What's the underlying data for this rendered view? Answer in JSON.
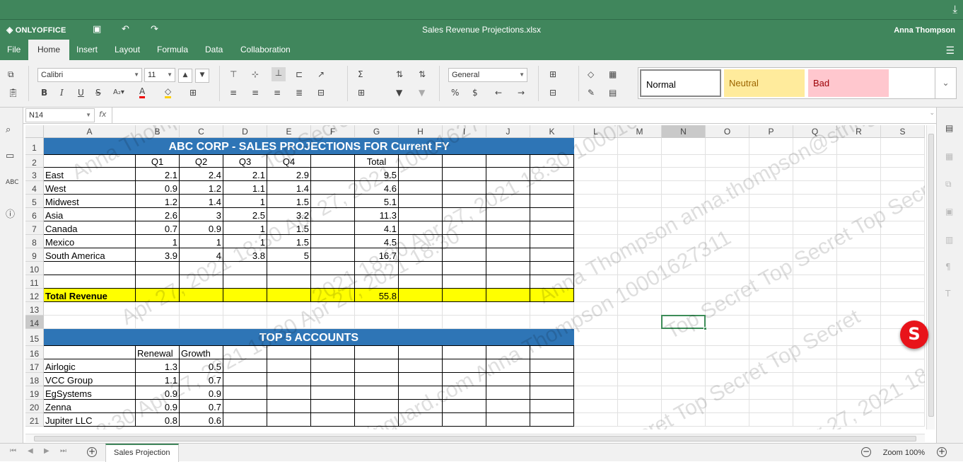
{
  "app": {
    "logo": "ONLYOFFICE",
    "document_title": "Sales Revenue Projections.xlsx",
    "user": "Anna Thompson"
  },
  "ribbon": {
    "tabs": [
      "File",
      "Home",
      "Insert",
      "Layout",
      "Formula",
      "Data",
      "Collaboration"
    ],
    "active_tab": "Home",
    "font_name": "Calibri",
    "font_size": "11",
    "number_format": "General",
    "cell_styles": [
      "Normal",
      "Neutral",
      "Bad"
    ]
  },
  "formula_bar": {
    "name_box": "N14",
    "fx_label": "fx",
    "formula": ""
  },
  "grid": {
    "columns": [
      "A",
      "B",
      "C",
      "D",
      "E",
      "F",
      "G",
      "H",
      "I",
      "J",
      "K",
      "L",
      "M",
      "N",
      "O",
      "P",
      "Q",
      "R",
      "S"
    ],
    "selected_column": "N",
    "rows": [
      "1",
      "2",
      "3",
      "4",
      "5",
      "6",
      "7",
      "8",
      "9",
      "10",
      "11",
      "12",
      "13",
      "14",
      "15",
      "16",
      "17",
      "18",
      "19",
      "20",
      "21"
    ],
    "selected_row": "14",
    "title1": "ABC CORP  - SALES PROJECTIONS FOR Current FY",
    "header_row": [
      "",
      "Q1",
      "Q2",
      "Q3",
      "Q4",
      "",
      "Total"
    ],
    "regions": [
      [
        "East",
        "2.1",
        "2.4",
        "2.1",
        "2.9",
        "",
        "9.5"
      ],
      [
        "West",
        "0.9",
        "1.2",
        "1.1",
        "1.4",
        "",
        "4.6"
      ],
      [
        "Midwest",
        "1.2",
        "1.4",
        "1",
        "1.5",
        "",
        "5.1"
      ],
      [
        "Asia",
        "2.6",
        "3",
        "2.5",
        "3.2",
        "",
        "11.3"
      ],
      [
        "Canada",
        "0.7",
        "0.9",
        "1",
        "1.5",
        "",
        "4.1"
      ],
      [
        "Mexico",
        "1",
        "1",
        "1",
        "1.5",
        "",
        "4.5"
      ],
      [
        "South America",
        "3.9",
        "4",
        "3.8",
        "5",
        "",
        "16.7"
      ]
    ],
    "total_label": "Total Revenue",
    "total_value": "55.8",
    "title2": "TOP 5 ACCOUNTS",
    "accounts_header": [
      "",
      "Renewal",
      "Growth"
    ],
    "accounts": [
      [
        "Airlogic",
        "1.3",
        "0.5"
      ],
      [
        "VCC Group",
        "1.1",
        "0.7"
      ],
      [
        "EgSystems",
        "0.9",
        "0.9"
      ],
      [
        "Zenna",
        "0.9",
        "0.7"
      ],
      [
        "Jupiter LLC",
        "0.8",
        "0.6"
      ]
    ]
  },
  "watermark": [
    "Anna Thompson anna.thompson@stringuard.com 16",
    "Top Secret Top Secret Top Secret 2021 16:",
    "Apr 27, 2021 18:30 Apr 27, 2021 10001627",
    "2021 18:30 Apr 27, 2021 18:30 100016273",
    "Anna Thompson anna.thompson@stringuard.com",
    "Top Secret Top Secret Top Secret Top Secret T",
    "18:30 Apr 27, 2021 18:30 Apr 27, 2021 18:30",
    "stringuard.com Anna Thompson 10001627311",
    "Top Secret Top Secret Top Secret",
    "Apr 27, 2021 18:30 100016273"
  ],
  "statusbar": {
    "sheet_tab": "Sales Projection",
    "zoom": "Zoom 100%"
  },
  "colors": {
    "brand_green": "#40865c",
    "title_band": "#2e75b6",
    "total_highlight": "#ffff00",
    "neutral_style": "#ffeb9c",
    "bad_style": "#ffc7ce"
  }
}
